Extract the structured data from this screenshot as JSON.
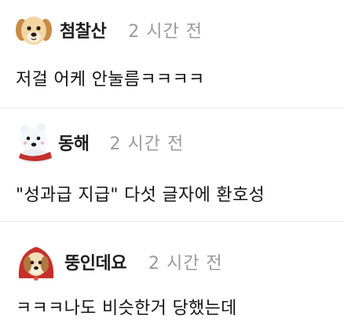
{
  "comments": [
    {
      "author": "첨찰산",
      "time": "2 시간 전",
      "text": "저걸 어케 안눌름ㅋㅋㅋㅋ",
      "avatar_icon": "golden-puppy-icon"
    },
    {
      "author": "동해",
      "time": "2 시간 전",
      "text": "\"성과급 지급\" 다섯 글자에 환호성",
      "avatar_icon": "polar-bear-icon"
    },
    {
      "author": "뚱인데요",
      "time": "2 시간 전",
      "text": "ㅋㅋㅋ나도 비슷한거 당했는데",
      "avatar_icon": "puppy-red-hood-icon"
    }
  ],
  "colors": {
    "author": "#1c1c1c",
    "time": "#9a9a9a",
    "divider": "#e6e6e6",
    "text": "#141414"
  }
}
